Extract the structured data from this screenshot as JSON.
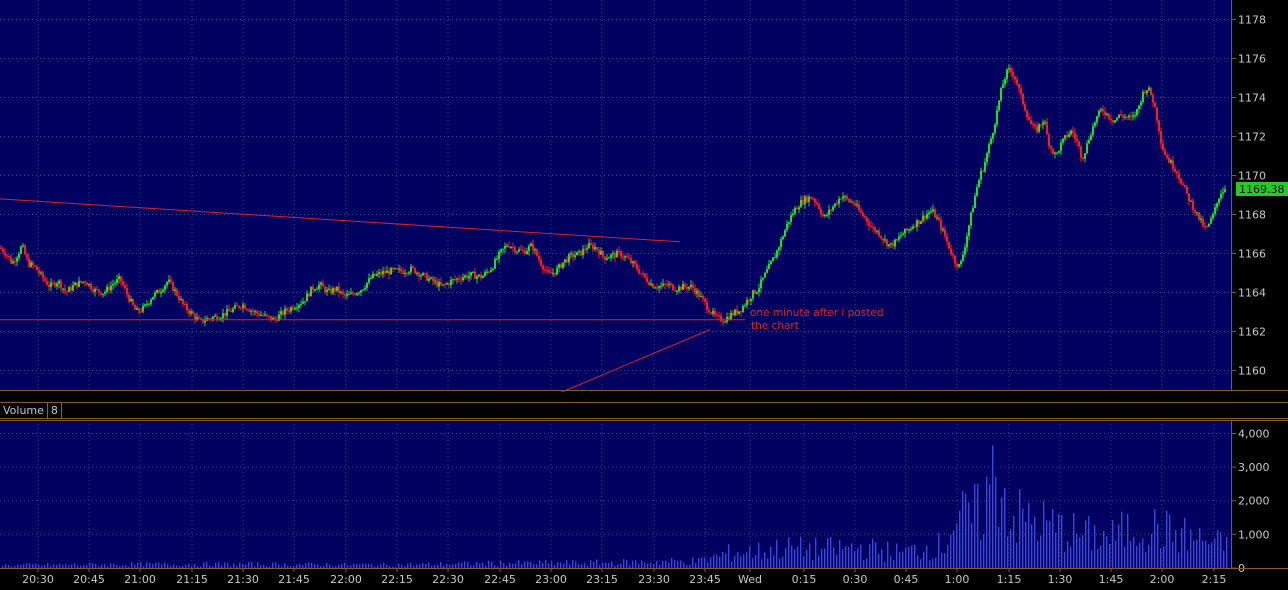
{
  "colors": {
    "background": "#000060",
    "up_candle": "#22dd22",
    "down_candle": "#ff1a1a",
    "grid": "#3b3b90",
    "axis_line": "#8a5a20",
    "axis_text": "#c8c8c8",
    "trendline": "#e02020",
    "annotation": "#e02020",
    "volume_bar": "#3848d8",
    "last_price_bg": "#22cc22"
  },
  "volume_tab": {
    "label": "Volume",
    "period": "8"
  },
  "chart_data": [
    {
      "type": "candlestick",
      "title": "",
      "ylim": [
        1159,
        1179
      ],
      "yticks": [
        "1160",
        "1162",
        "1164",
        "1166",
        "1168",
        "1170",
        "1172",
        "1174",
        "1176",
        "1178"
      ],
      "grid": true,
      "last_price_label": "1169.38",
      "close_path": [
        [
          0,
          1166.3
        ],
        [
          6,
          1166.0
        ],
        [
          12,
          1165.5
        ],
        [
          17,
          1165.9
        ],
        [
          22,
          1166.4
        ],
        [
          28,
          1165.5
        ],
        [
          35,
          1165.3
        ],
        [
          42,
          1164.8
        ],
        [
          50,
          1164.3
        ],
        [
          58,
          1164.6
        ],
        [
          66,
          1164.0
        ],
        [
          75,
          1164.4
        ],
        [
          85,
          1164.6
        ],
        [
          95,
          1164.1
        ],
        [
          104,
          1164.0
        ],
        [
          112,
          1164.4
        ],
        [
          120,
          1164.7
        ],
        [
          128,
          1163.8
        ],
        [
          136,
          1163.0
        ],
        [
          144,
          1163.2
        ],
        [
          152,
          1163.8
        ],
        [
          160,
          1164.1
        ],
        [
          168,
          1164.6
        ],
        [
          176,
          1164.0
        ],
        [
          184,
          1163.3
        ],
        [
          192,
          1162.9
        ],
        [
          200,
          1162.5
        ],
        [
          210,
          1162.7
        ],
        [
          220,
          1162.8
        ],
        [
          232,
          1163.1
        ],
        [
          242,
          1163.4
        ],
        [
          254,
          1163.0
        ],
        [
          264,
          1162.8
        ],
        [
          274,
          1162.6
        ],
        [
          284,
          1163.0
        ],
        [
          294,
          1163.3
        ],
        [
          304,
          1163.6
        ],
        [
          312,
          1164.2
        ],
        [
          320,
          1164.4
        ],
        [
          328,
          1164.0
        ],
        [
          336,
          1164.2
        ],
        [
          344,
          1163.8
        ],
        [
          352,
          1163.9
        ],
        [
          362,
          1164.2
        ],
        [
          372,
          1164.8
        ],
        [
          382,
          1165.0
        ],
        [
          392,
          1165.1
        ],
        [
          402,
          1165.1
        ],
        [
          412,
          1165.2
        ],
        [
          422,
          1164.9
        ],
        [
          432,
          1164.6
        ],
        [
          442,
          1164.3
        ],
        [
          452,
          1164.6
        ],
        [
          462,
          1164.8
        ],
        [
          472,
          1164.9
        ],
        [
          482,
          1164.8
        ],
        [
          492,
          1165.3
        ],
        [
          500,
          1166.0
        ],
        [
          508,
          1166.5
        ],
        [
          516,
          1166.2
        ],
        [
          524,
          1166.1
        ],
        [
          532,
          1166.4
        ],
        [
          540,
          1165.6
        ],
        [
          548,
          1164.9
        ],
        [
          556,
          1165.1
        ],
        [
          564,
          1165.6
        ],
        [
          572,
          1165.9
        ],
        [
          580,
          1166.0
        ],
        [
          588,
          1166.4
        ],
        [
          596,
          1166.3
        ],
        [
          604,
          1165.8
        ],
        [
          612,
          1165.9
        ],
        [
          620,
          1166.0
        ],
        [
          628,
          1165.7
        ],
        [
          636,
          1165.3
        ],
        [
          644,
          1164.8
        ],
        [
          652,
          1164.4
        ],
        [
          660,
          1164.3
        ],
        [
          668,
          1164.4
        ],
        [
          676,
          1164.2
        ],
        [
          684,
          1164.3
        ],
        [
          692,
          1164.3
        ],
        [
          700,
          1163.8
        ],
        [
          708,
          1163.2
        ],
        [
          716,
          1162.7
        ],
        [
          724,
          1162.6
        ],
        [
          732,
          1162.9
        ],
        [
          740,
          1163.1
        ],
        [
          746,
          1163.5
        ],
        [
          752,
          1163.9
        ],
        [
          758,
          1164.2
        ],
        [
          764,
          1164.8
        ],
        [
          770,
          1165.4
        ],
        [
          776,
          1166.0
        ],
        [
          782,
          1166.8
        ],
        [
          788,
          1167.6
        ],
        [
          794,
          1168.2
        ],
        [
          800,
          1168.6
        ],
        [
          806,
          1168.8
        ],
        [
          812,
          1168.9
        ],
        [
          818,
          1168.5
        ],
        [
          824,
          1167.8
        ],
        [
          830,
          1168.2
        ],
        [
          836,
          1168.6
        ],
        [
          842,
          1169.0
        ],
        [
          848,
          1168.7
        ],
        [
          854,
          1168.6
        ],
        [
          860,
          1168.1
        ],
        [
          866,
          1167.8
        ],
        [
          872,
          1167.3
        ],
        [
          878,
          1167.1
        ],
        [
          884,
          1166.7
        ],
        [
          890,
          1166.4
        ],
        [
          896,
          1166.6
        ],
        [
          902,
          1167.0
        ],
        [
          908,
          1167.2
        ],
        [
          914,
          1167.5
        ],
        [
          920,
          1167.7
        ],
        [
          926,
          1168.0
        ],
        [
          932,
          1168.2
        ],
        [
          938,
          1167.7
        ],
        [
          944,
          1167.0
        ],
        [
          950,
          1166.2
        ],
        [
          955,
          1165.6
        ],
        [
          960,
          1165.3
        ],
        [
          964,
          1166.2
        ],
        [
          968,
          1167.2
        ],
        [
          972,
          1168.2
        ],
        [
          976,
          1169.2
        ],
        [
          980,
          1170.0
        ],
        [
          984,
          1170.5
        ],
        [
          988,
          1171.3
        ],
        [
          992,
          1172.1
        ],
        [
          996,
          1173.0
        ],
        [
          1000,
          1174.1
        ],
        [
          1004,
          1174.9
        ],
        [
          1008,
          1175.4
        ],
        [
          1012,
          1175.3
        ],
        [
          1016,
          1174.9
        ],
        [
          1020,
          1174.2
        ],
        [
          1024,
          1173.6
        ],
        [
          1028,
          1173.0
        ],
        [
          1032,
          1172.5
        ],
        [
          1036,
          1172.3
        ],
        [
          1040,
          1172.6
        ],
        [
          1044,
          1172.9
        ],
        [
          1048,
          1171.8
        ],
        [
          1052,
          1171.3
        ],
        [
          1056,
          1171.0
        ],
        [
          1060,
          1171.5
        ],
        [
          1066,
          1172.0
        ],
        [
          1072,
          1172.3
        ],
        [
          1078,
          1171.6
        ],
        [
          1082,
          1170.9
        ],
        [
          1086,
          1171.4
        ],
        [
          1090,
          1172.1
        ],
        [
          1096,
          1172.9
        ],
        [
          1102,
          1173.4
        ],
        [
          1108,
          1173.1
        ],
        [
          1114,
          1172.8
        ],
        [
          1120,
          1173.1
        ],
        [
          1126,
          1173.0
        ],
        [
          1132,
          1172.9
        ],
        [
          1138,
          1173.4
        ],
        [
          1142,
          1174.1
        ],
        [
          1146,
          1174.5
        ],
        [
          1150,
          1174.3
        ],
        [
          1154,
          1173.7
        ],
        [
          1158,
          1172.7
        ],
        [
          1162,
          1171.5
        ],
        [
          1166,
          1171.0
        ],
        [
          1170,
          1170.7
        ],
        [
          1176,
          1170.3
        ],
        [
          1182,
          1169.6
        ],
        [
          1188,
          1168.9
        ],
        [
          1194,
          1168.3
        ],
        [
          1200,
          1167.7
        ],
        [
          1206,
          1167.2
        ],
        [
          1212,
          1167.8
        ],
        [
          1216,
          1168.4
        ],
        [
          1220,
          1169.1
        ],
        [
          1226,
          1169.38
        ]
      ],
      "annotations": [
        {
          "type": "line",
          "x1": 0,
          "y1": 1168.8,
          "x2": 680,
          "y2": 1166.6
        },
        {
          "type": "line",
          "x1": 0,
          "y1": 1162.6,
          "x2": 745,
          "y2": 1162.6
        },
        {
          "type": "line",
          "x1": 562,
          "y1": 1158.9,
          "x2": 710,
          "y2": 1162.1
        },
        {
          "type": "text",
          "lines": [
            "one minute after i posted",
            "the chart"
          ],
          "x": 750,
          "y": 1162.8
        }
      ]
    },
    {
      "type": "bar",
      "series_label": "Volume",
      "ylim": [
        0,
        4400
      ],
      "yticks": [
        "4,000",
        "3,000",
        "2,000",
        "1,000",
        "0"
      ],
      "volume_profile": [
        [
          0,
          120
        ],
        [
          100,
          150
        ],
        [
          200,
          160
        ],
        [
          300,
          150
        ],
        [
          400,
          140
        ],
        [
          500,
          200
        ],
        [
          600,
          220
        ],
        [
          700,
          300
        ],
        [
          730,
          650
        ],
        [
          760,
          700
        ],
        [
          780,
          850
        ],
        [
          820,
          800
        ],
        [
          860,
          850
        ],
        [
          900,
          650
        ],
        [
          945,
          1000
        ],
        [
          950,
          1900
        ],
        [
          980,
          2300
        ],
        [
          996,
          4200
        ],
        [
          1010,
          2200
        ],
        [
          1040,
          1900
        ],
        [
          1080,
          1400
        ],
        [
          1110,
          1300
        ],
        [
          1140,
          1800
        ],
        [
          1170,
          1500
        ],
        [
          1200,
          1200
        ],
        [
          1230,
          900
        ]
      ],
      "xticks": [
        {
          "label": "20:30",
          "x": 38
        },
        {
          "label": "20:45",
          "x": 89
        },
        {
          "label": "21:00",
          "x": 140
        },
        {
          "label": "21:15",
          "x": 192
        },
        {
          "label": "21:30",
          "x": 243
        },
        {
          "label": "21:45",
          "x": 294
        },
        {
          "label": "22:00",
          "x": 346
        },
        {
          "label": "22:15",
          "x": 397
        },
        {
          "label": "22:30",
          "x": 448
        },
        {
          "label": "22:45",
          "x": 500
        },
        {
          "label": "23:00",
          "x": 551
        },
        {
          "label": "23:15",
          "x": 602
        },
        {
          "label": "23:30",
          "x": 654
        },
        {
          "label": "23:45",
          "x": 705
        },
        {
          "label": "Wed",
          "x": 750
        },
        {
          "label": "0:15",
          "x": 804
        },
        {
          "label": "0:30",
          "x": 855
        },
        {
          "label": "0:45",
          "x": 906
        },
        {
          "label": "1:00",
          "x": 957
        },
        {
          "label": "1:15",
          "x": 1009
        },
        {
          "label": "1:30",
          "x": 1060
        },
        {
          "label": "1:45",
          "x": 1111
        },
        {
          "label": "2:00",
          "x": 1162
        },
        {
          "label": "2:15",
          "x": 1214
        }
      ]
    }
  ]
}
